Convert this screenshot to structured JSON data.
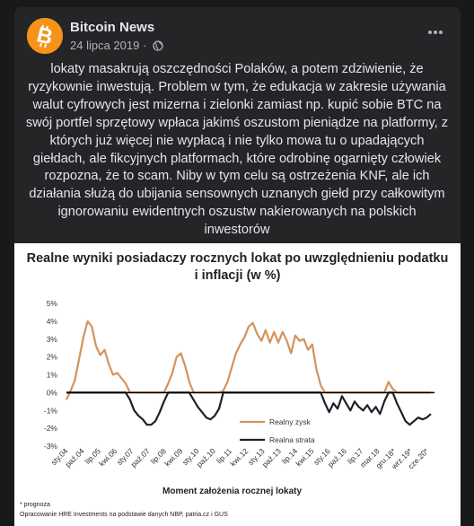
{
  "post": {
    "page_name": "Bitcoin News",
    "date": "24 lipca 2019 ·",
    "text": "lokaty masakrują oszczędności Polaków, a potem zdziwienie, że ryzykownie inwestują. Problem w tym, że edukacja w zakresie używania walut cyfrowych jest mizerna i zielonki zamiast np. kupić sobie BTC na swój portfel sprzętowy wpłaca jakimś oszustom pieniądze na platformy, z których już więcej nie wypłacą i nie tylko mowa tu o upadających giełdach, ale fikcyjnych platformach, które odrobinę ogarnięty człowiek rozpozna, że to scam. Niby w tym celu są ostrzeżenia KNF, ale ich działania służą do ubijania sensownych uznanych giełd przy całkowitym ignorowaniu ewidentnych oszustw nakierowanych na polskich inwestorów",
    "avatar_color": "#f7931a",
    "icons": {
      "avatar": "bitcoin-logo",
      "privacy": "globe-icon",
      "menu": "more-options-icon"
    }
  },
  "chart_data": {
    "type": "line",
    "title": "Realne wyniki posiadaczy rocznych lokat po uwzględnieniu podatku i inflacji (w %)",
    "xlabel": "Moment założenia rocznej lokaty",
    "ylabel": "",
    "ylim": [
      -3,
      5
    ],
    "yticks": [
      "5%",
      "4%",
      "3%",
      "2%",
      "1%",
      "0%",
      "-1%",
      "-2%",
      "-3%"
    ],
    "categories": [
      "sty.04",
      "paź.04",
      "lip.05",
      "kwi.06",
      "sty.07",
      "paź.07",
      "lip.08",
      "kwi.09",
      "sty.10",
      "paź.10",
      "lip.11",
      "kwi.12",
      "sty.13",
      "paź.13",
      "lip.14",
      "kwi.15",
      "sty.16",
      "paź.16",
      "lip.17",
      "mar.18",
      "gru.18*",
      "wrz.19*",
      "cze.20*"
    ],
    "legend": {
      "position": "right",
      "entries": [
        "Realny zysk",
        "Realna strata"
      ]
    },
    "grid": false,
    "colors": {
      "gain": "#d4935b",
      "loss": "#1f1f2a"
    },
    "series": [
      {
        "name": "Realny zysk",
        "y": [
          -0.4,
          0.1,
          0.7,
          1.9,
          3.1,
          4.0,
          3.7,
          2.6,
          2.1,
          2.4,
          1.6,
          1.0,
          1.1,
          0.8,
          0.5,
          0.0,
          0.0,
          0.0,
          0.0,
          0.0,
          0.0,
          0.0,
          0.0,
          0.0,
          0.5,
          1.1,
          2.0,
          2.2,
          1.5,
          0.6,
          0.0,
          0.0,
          0.0,
          0.0,
          0.0,
          0.0,
          0.0,
          0.1,
          0.6,
          1.4,
          2.2,
          2.7,
          3.1,
          3.7,
          3.9,
          3.3,
          2.9,
          3.5,
          2.8,
          3.4,
          2.8,
          3.4,
          2.9,
          2.2,
          3.2,
          2.9,
          3.0,
          2.4,
          2.7,
          1.3,
          0.4,
          0.0,
          0.0,
          0.0,
          0.0,
          0.0,
          0.0,
          0.0,
          0.0,
          0.0,
          0.0,
          0.0,
          0.0,
          0.0,
          0.0,
          0.0,
          0.6,
          0.2,
          0.0,
          0.0,
          0.0,
          0.0,
          0.0,
          0.0,
          0.0,
          0.0,
          0.0
        ]
      },
      {
        "name": "Realna strata",
        "y": [
          0.0,
          0.0,
          0.0,
          0.0,
          0.0,
          0.0,
          0.0,
          0.0,
          0.0,
          0.0,
          0.0,
          0.0,
          0.0,
          0.0,
          0.0,
          -0.4,
          -1.0,
          -1.3,
          -1.5,
          -1.8,
          -1.8,
          -1.6,
          -1.1,
          -0.5,
          0.0,
          0.0,
          0.0,
          0.0,
          0.0,
          0.0,
          -0.4,
          -0.8,
          -1.1,
          -1.4,
          -1.5,
          -1.3,
          -0.9,
          0.0,
          0.0,
          0.0,
          0.0,
          0.0,
          0.0,
          0.0,
          0.0,
          0.0,
          0.0,
          0.0,
          0.0,
          0.0,
          0.0,
          0.0,
          0.0,
          0.0,
          0.0,
          0.0,
          0.0,
          0.0,
          0.0,
          0.0,
          0.0,
          -0.6,
          -1.1,
          -0.6,
          -0.9,
          -0.2,
          -0.6,
          -1.0,
          -0.5,
          -0.8,
          -1.0,
          -0.7,
          -1.1,
          -0.8,
          -1.2,
          -0.5,
          0.0,
          0.0,
          -0.6,
          -1.1,
          -1.6,
          -1.8,
          -1.6,
          -1.4,
          -1.5,
          -1.4,
          -1.2
        ]
      }
    ],
    "notes": [
      "* prognoza",
      "Opracowanie HRE Investments na podstawie danych NBP, patria.cz i GUS"
    ]
  }
}
